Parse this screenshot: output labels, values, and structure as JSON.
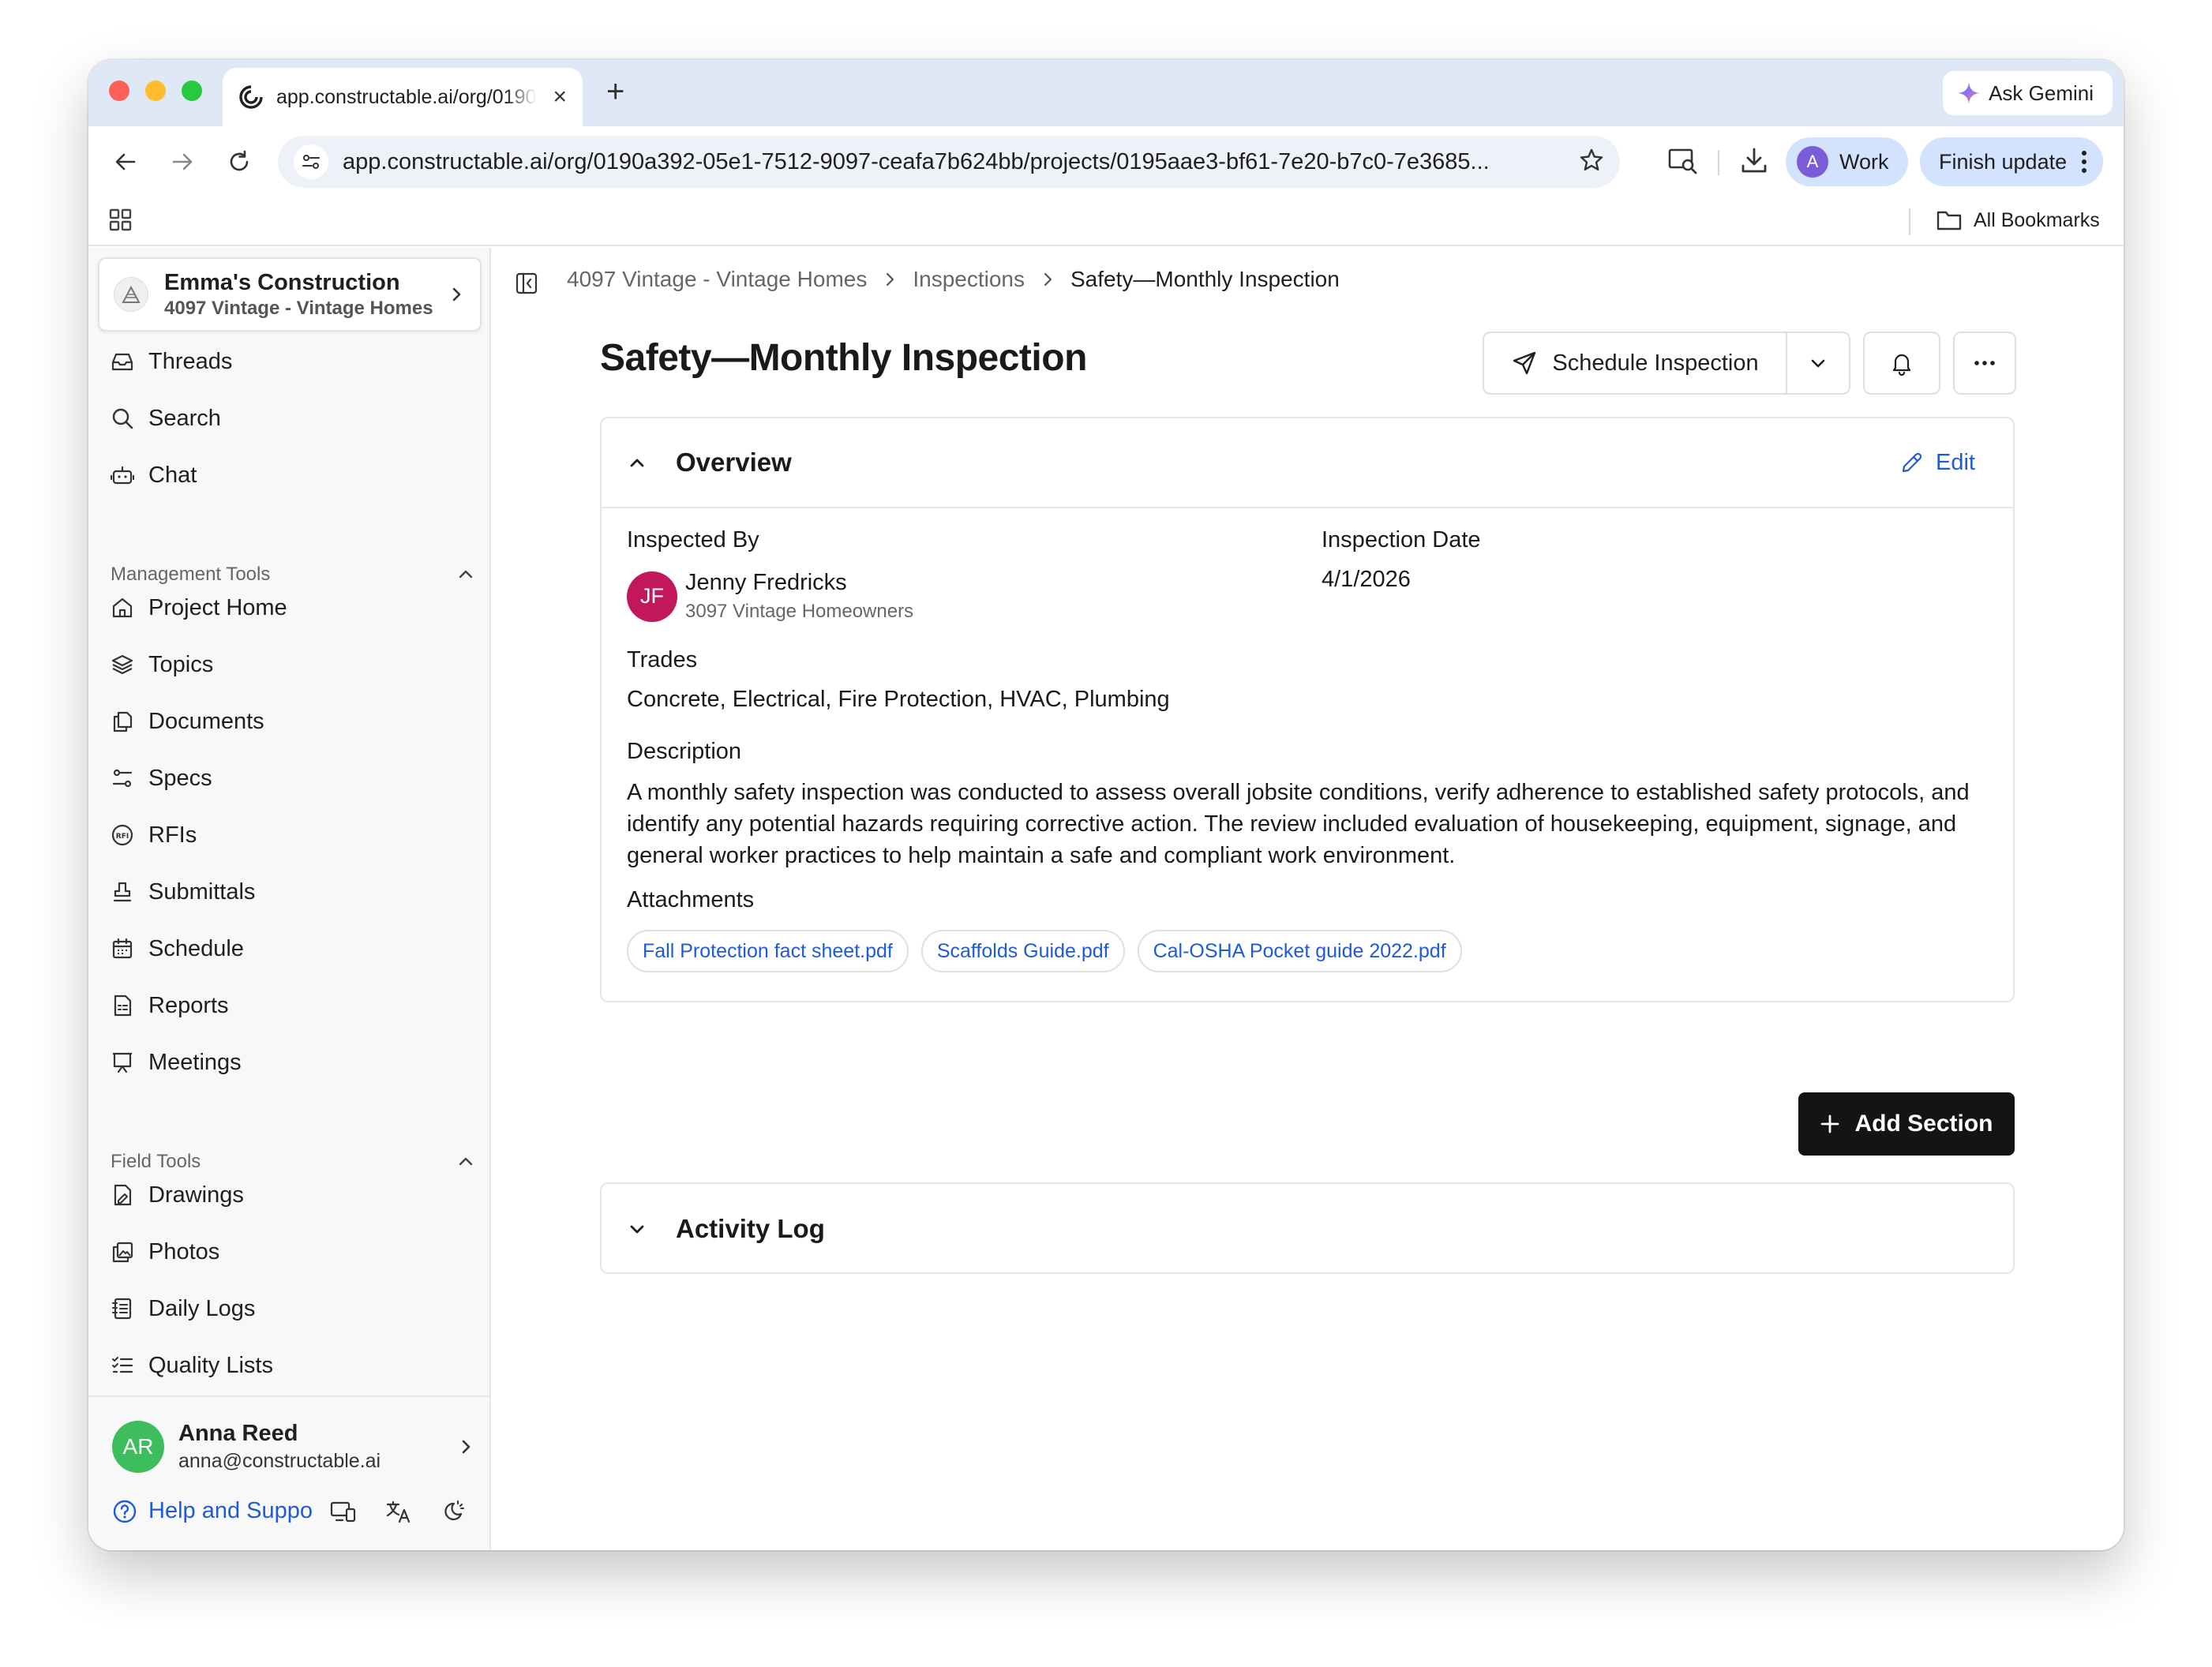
{
  "browser": {
    "tab_title": "app.constructable.ai/org/0190a392-05e1",
    "tab_close": "×",
    "new_tab": "+",
    "ask_gemini": "Ask Gemini",
    "url": "app.constructable.ai/org/0190a392-05e1-7512-9097-ceafa7b624bb/projects/0195aae3-bf61-7e20-b7c0-7e3685...",
    "profile_initial": "A",
    "profile_label": "Work",
    "finish_update": "Finish update",
    "all_bookmarks": "All Bookmarks"
  },
  "org": {
    "name": "Emma's Construction",
    "project": "4097 Vintage - Vintage Homes"
  },
  "sidebar": {
    "top_items": [
      {
        "label": "Threads",
        "icon": "inbox-icon"
      },
      {
        "label": "Search",
        "icon": "search-icon"
      },
      {
        "label": "Chat",
        "icon": "bot-icon"
      }
    ],
    "management_label": "Management Tools",
    "management_items": [
      {
        "label": "Project Home",
        "icon": "home-icon"
      },
      {
        "label": "Topics",
        "icon": "layers-icon"
      },
      {
        "label": "Documents",
        "icon": "documents-icon"
      },
      {
        "label": "Specs",
        "icon": "specs-icon"
      },
      {
        "label": "RFIs",
        "icon": "rfi-icon"
      },
      {
        "label": "Submittals",
        "icon": "stamp-icon"
      },
      {
        "label": "Schedule",
        "icon": "calendar-icon"
      },
      {
        "label": "Reports",
        "icon": "report-icon"
      },
      {
        "label": "Meetings",
        "icon": "presentation-icon"
      }
    ],
    "field_label": "Field Tools",
    "field_items": [
      {
        "label": "Drawings",
        "icon": "drawing-icon"
      },
      {
        "label": "Photos",
        "icon": "photos-icon"
      },
      {
        "label": "Daily Logs",
        "icon": "notebook-icon"
      },
      {
        "label": "Quality Lists",
        "icon": "checklist-icon"
      }
    ],
    "user": {
      "initials": "AR",
      "name": "Anna Reed",
      "email": "anna@constructable.ai"
    },
    "help_label": "Help and Suppo"
  },
  "breadcrumb": {
    "project": "4097 Vintage - Vintage Homes",
    "section": "Inspections",
    "current": "Safety—Monthly Inspection"
  },
  "page": {
    "title": "Safety—Monthly Inspection",
    "schedule_button": "Schedule Inspection"
  },
  "overview": {
    "title": "Overview",
    "edit_label": "Edit",
    "inspected_by_label": "Inspected By",
    "inspector_initials": "JF",
    "inspector_name": "Jenny Fredricks",
    "inspector_org": "3097 Vintage Homeowners",
    "inspection_date_label": "Inspection Date",
    "inspection_date": "4/1/2026",
    "trades_label": "Trades",
    "trades": "Concrete, Electrical, Fire Protection, HVAC, Plumbing",
    "description_label": "Description",
    "description": "A monthly safety inspection was conducted to assess overall jobsite conditions, verify adherence to established safety protocols, and identify any potential hazards requiring corrective action. The review included evaluation of housekeeping, equipment, signage, and general worker practices to help maintain a safe and compliant work environment.",
    "attachments_label": "Attachments",
    "attachments": [
      "Fall Protection fact sheet.pdf",
      "Scaffolds Guide.pdf",
      "Cal-OSHA Pocket guide 2022.pdf"
    ]
  },
  "add_section_label": "Add Section",
  "activity_log": {
    "title": "Activity Log"
  },
  "colors": {
    "link_blue": "#1f5bd8",
    "inspector_avatar": "#c2185b",
    "user_avatar": "#3dbd5b",
    "primary_button": "#141414"
  }
}
